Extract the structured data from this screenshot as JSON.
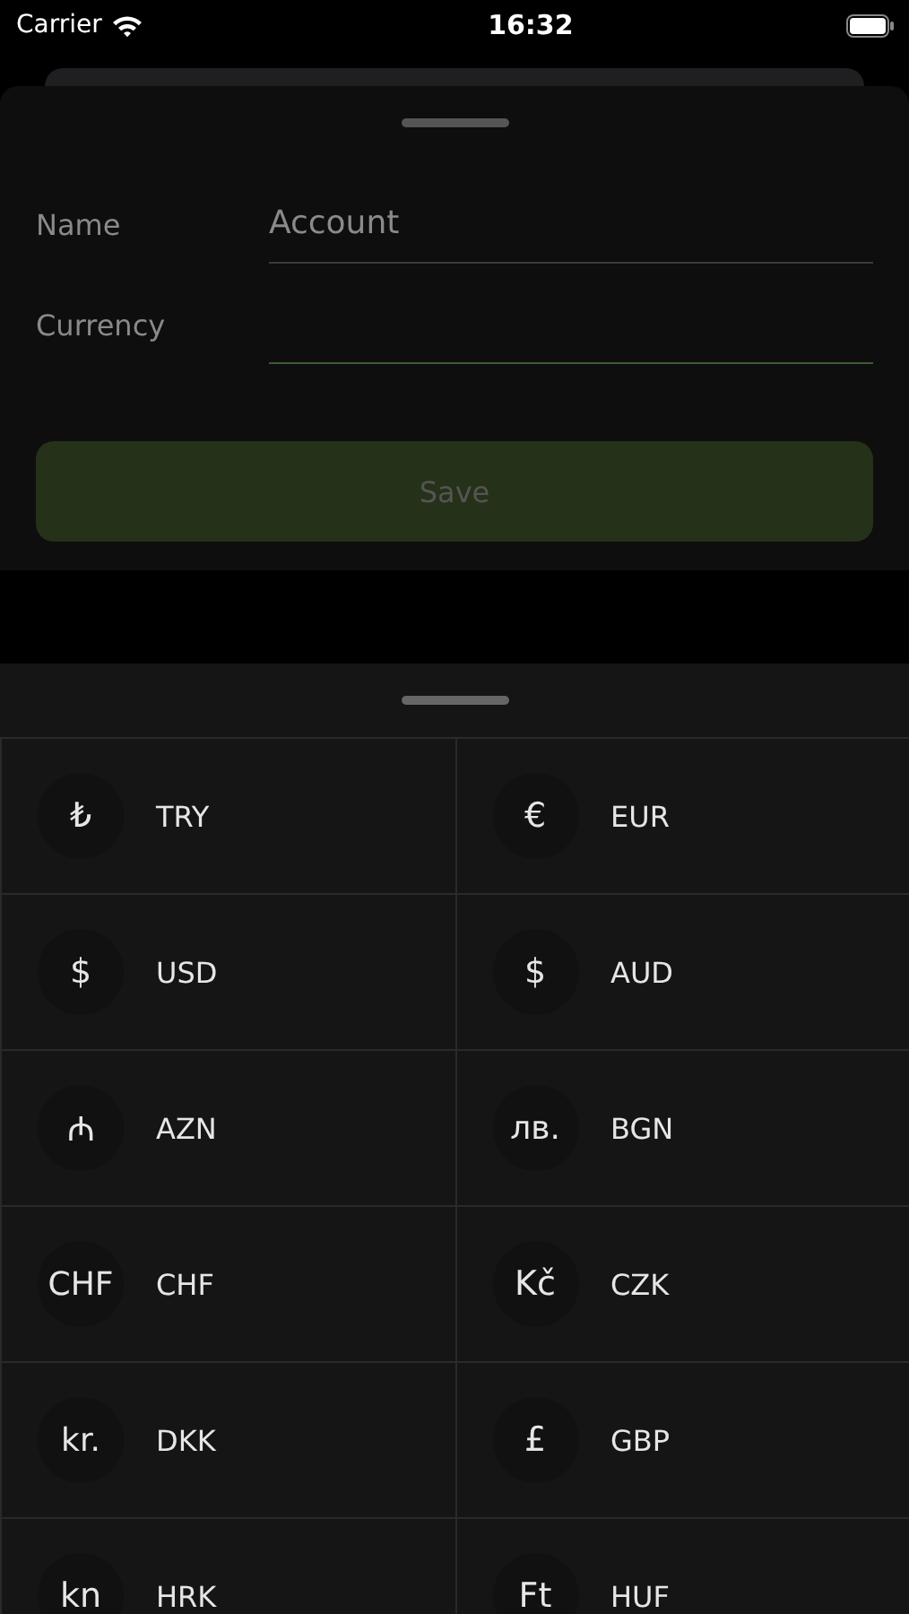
{
  "status_bar": {
    "carrier": "Carrier",
    "time": "16:32"
  },
  "form": {
    "fields": [
      {
        "label": "Name",
        "placeholder": "Account",
        "focused": false
      },
      {
        "label": "Currency",
        "focused": true
      }
    ],
    "save_button": {
      "label": "Save",
      "disabled": true
    }
  },
  "currencies": [
    {
      "symbol": "₺",
      "code": "TRY"
    },
    {
      "symbol": "€",
      "code": "EUR"
    },
    {
      "symbol": "$",
      "code": "USD"
    },
    {
      "symbol": "$",
      "code": "AUD"
    },
    {
      "symbol": "₼",
      "code": "AZN"
    },
    {
      "symbol": "лв.",
      "code": "BGN"
    },
    {
      "symbol": "CHF",
      "code": "CHF"
    },
    {
      "symbol": "Kč",
      "code": "CZK"
    },
    {
      "symbol": "kr.",
      "code": "DKK"
    },
    {
      "symbol": "£",
      "code": "GBP"
    },
    {
      "symbol": "kn",
      "code": "HRK"
    },
    {
      "symbol": "Ft",
      "code": "HUF"
    }
  ]
}
